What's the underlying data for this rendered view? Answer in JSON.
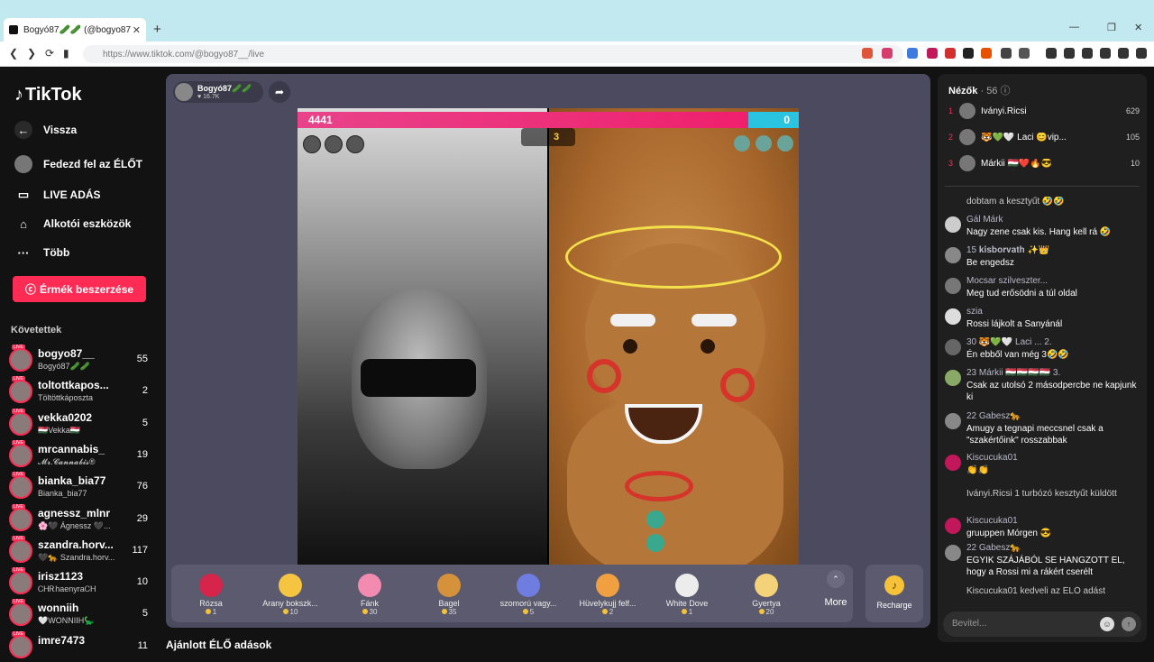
{
  "browser": {
    "tab_title": "Bogyó87🥒🥒 (@bogyo87",
    "url": "https://www.tiktok.com/@bogyo87__/live"
  },
  "sidebar": {
    "logo": "TikTok",
    "back": "Vissza",
    "explore": "Fedezd fel az ÉLŐT",
    "live": "LIVE ADÁS",
    "creator": "Alkotói eszközök",
    "more": "Több",
    "coins_button": "Érmék beszerzése",
    "following_heading": "Követettek",
    "following": [
      {
        "name": "bogyo87__",
        "sub": "Bogyó87🥒🥒",
        "count": "55"
      },
      {
        "name": "toltottkapos...",
        "sub": "Töltöttkáposzta",
        "count": "2"
      },
      {
        "name": "vekka0202",
        "sub": "🇭🇺Vekka🇭🇺",
        "count": "5"
      },
      {
        "name": "mrcannabis_",
        "sub": "𝓜𝓻.𝓒𝓪𝓷𝓷𝓪𝓫𝓲𝓼®",
        "count": "19"
      },
      {
        "name": "bianka_bia77",
        "sub": "Bianka_bia77",
        "count": "76"
      },
      {
        "name": "agnessz_mlnr",
        "sub": "🌸🖤 Ágnessz 🖤...",
        "count": "29"
      },
      {
        "name": "szandra.horv...",
        "sub": "🖤🐆 Szandra.horv...",
        "count": "117"
      },
      {
        "name": "irisz1123",
        "sub": "ᏟᎻᎡhaenyraᏟᎻ",
        "count": "10"
      },
      {
        "name": "wonniih",
        "sub": "🤍WONNIIH🦕",
        "count": "5"
      },
      {
        "name": "imre7473",
        "sub": "",
        "count": "11"
      }
    ]
  },
  "stream": {
    "host_name": "Bogyó87🥒🥒",
    "host_likes": "♥ 16.7K",
    "score_left": "4441",
    "score_right": "0",
    "round": "3"
  },
  "gifts": [
    {
      "name": "Rózsa",
      "price": "1",
      "color": "#d6244a"
    },
    {
      "name": "Arany bokszk...",
      "price": "10",
      "color": "#f5c542"
    },
    {
      "name": "Fánk",
      "price": "30",
      "color": "#f38bb0"
    },
    {
      "name": "Bagel",
      "price": "35",
      "color": "#d6923a"
    },
    {
      "name": "szomorú vagy...",
      "price": "5",
      "color": "#6f7de0"
    },
    {
      "name": "Hüvelykujj felf...",
      "price": "2",
      "color": "#f0a040"
    },
    {
      "name": "White Dove",
      "price": "1",
      "color": "#ececec"
    },
    {
      "name": "Gyertya",
      "price": "20",
      "color": "#f4d27a"
    }
  ],
  "gift_more": "More",
  "recharge": "Recharge",
  "recommended": "Ajánlott ÉLŐ adások",
  "chat": {
    "viewers_label": "Nézők",
    "viewers_count": "· 56",
    "top": [
      {
        "rank": "1",
        "name": "Iványi.Ricsi",
        "score": "629"
      },
      {
        "rank": "2",
        "name": "🐯💚🤍 Laci 😊vip...",
        "score": "105"
      },
      {
        "rank": "3",
        "name": "Márkii 🇭🇺❤️🔥😎",
        "score": "10"
      }
    ],
    "messages": [
      {
        "name": "",
        "text": "dobtam a kesztyűt 🤣🤣"
      },
      {
        "name": "Gál Márk",
        "text": "Nagy zene csak kis. Hang kell rá 🤣"
      },
      {
        "name": "15 𝐤𝐢𝐬𝐛𝐨𝐫𝐯𝐚𝐭𝐡 ✨👑",
        "text": "Be engedsz"
      },
      {
        "name": "Mocsar szilveszter...",
        "text": "Meg tud erősödni a túl oldal"
      },
      {
        "name": "szia",
        "text": "Rossi lájkolt a Sanyánál"
      },
      {
        "name": "30 🐯💚🤍 Laci ... 2.",
        "text": "Én ebből van még 3🤣🤣"
      },
      {
        "name": "23 Márkii 🇭🇺🇭🇺🇭🇺🇭🇺 3.",
        "text": "Csak az utolsó 2 másodpercbe ne kapjunk ki"
      },
      {
        "name": "22 Gabesz🐆",
        "text": "Amugy a tegnapi meccsnel csak a \"szakértőink\" rosszabbak"
      },
      {
        "name": "Kiscucuka01",
        "text": "👏👏"
      },
      {
        "name": "",
        "text": "Iványi.Ricsi 1 turbózó kesztyűt küldött"
      },
      {
        "name": "Kiscucuka01",
        "text": "gruuppen Mórgen 😎"
      },
      {
        "name": "22 Gabesz🐆",
        "text": "EGYIK SZÁJÁBÓL SE HANGZOTT EL, hogy a Rossi mi a rákért cserélt"
      },
      {
        "name": "",
        "text": "Kiscucuka01 kedveli az ÉLŐ adást"
      }
    ],
    "input_placeholder": "Bevitel..."
  }
}
